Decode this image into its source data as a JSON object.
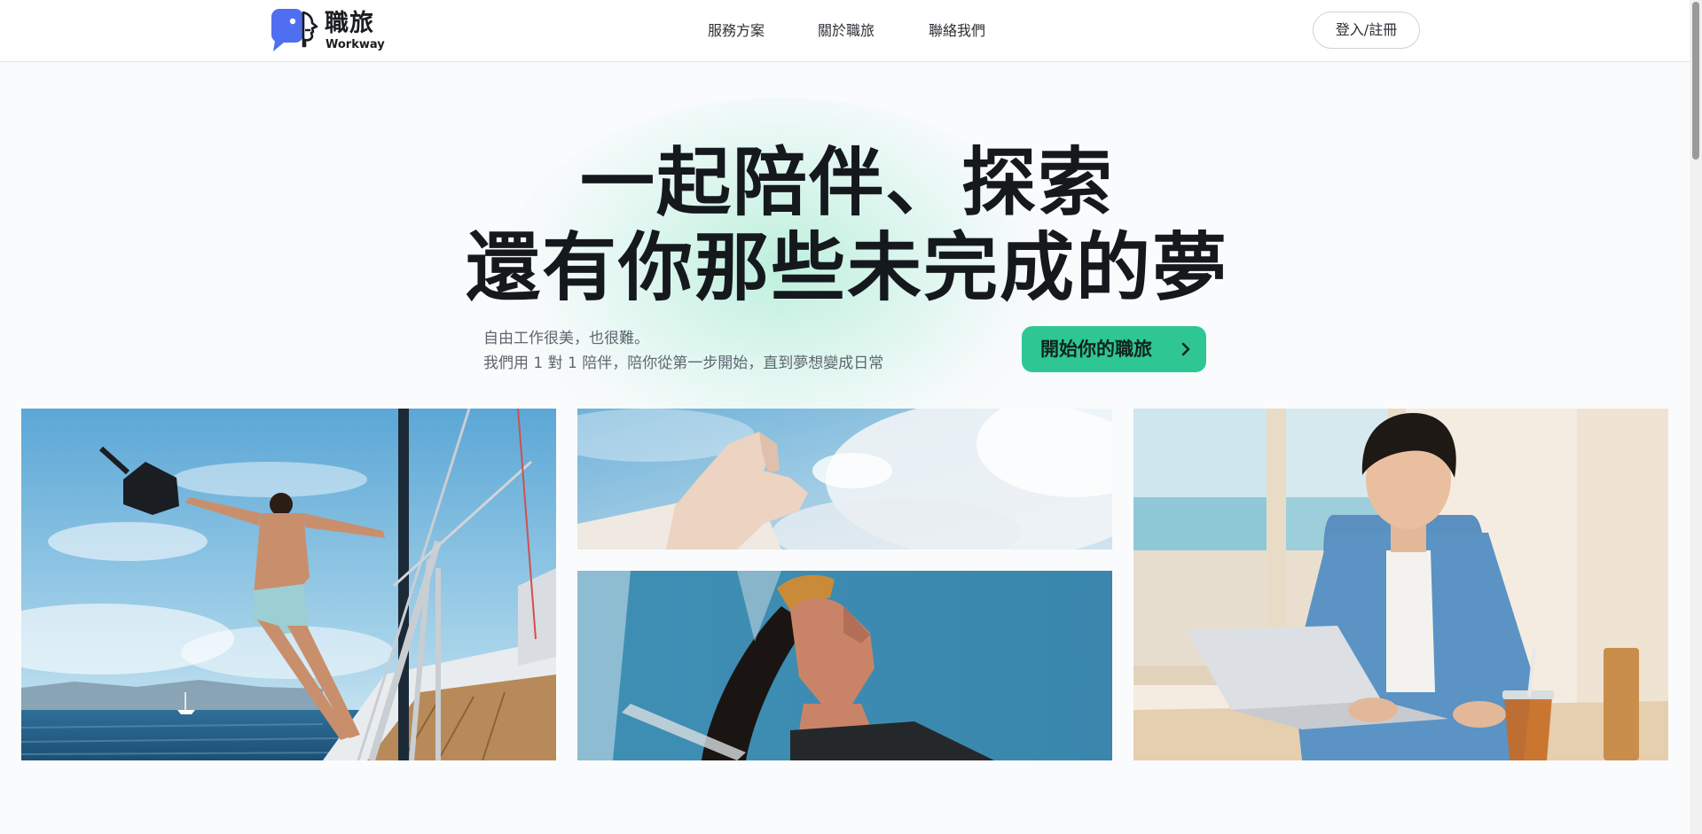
{
  "header": {
    "logo_name": "職旅",
    "logo_sub": "Workway",
    "nav": [
      "服務方案",
      "關於職旅",
      "聯絡我們"
    ],
    "login_label": "登入/註冊"
  },
  "hero": {
    "title_line1": "一起陪伴、探索",
    "title_line2": "還有你那些未完成的夢",
    "desc_line1": "自由工作很美，也很難。",
    "desc_line2": "我們用 1 對 1 陪伴，陪你從第一步開始，直到夢想變成日常",
    "cta_label": "開始你的職旅"
  },
  "icons": {
    "logo": "speech-bubble-face-logo-icon",
    "cta": "chevron-right-icon"
  },
  "colors": {
    "accent": "#2ec793",
    "logo_blue": "#4f6ef0",
    "text_dark": "#15191e"
  }
}
